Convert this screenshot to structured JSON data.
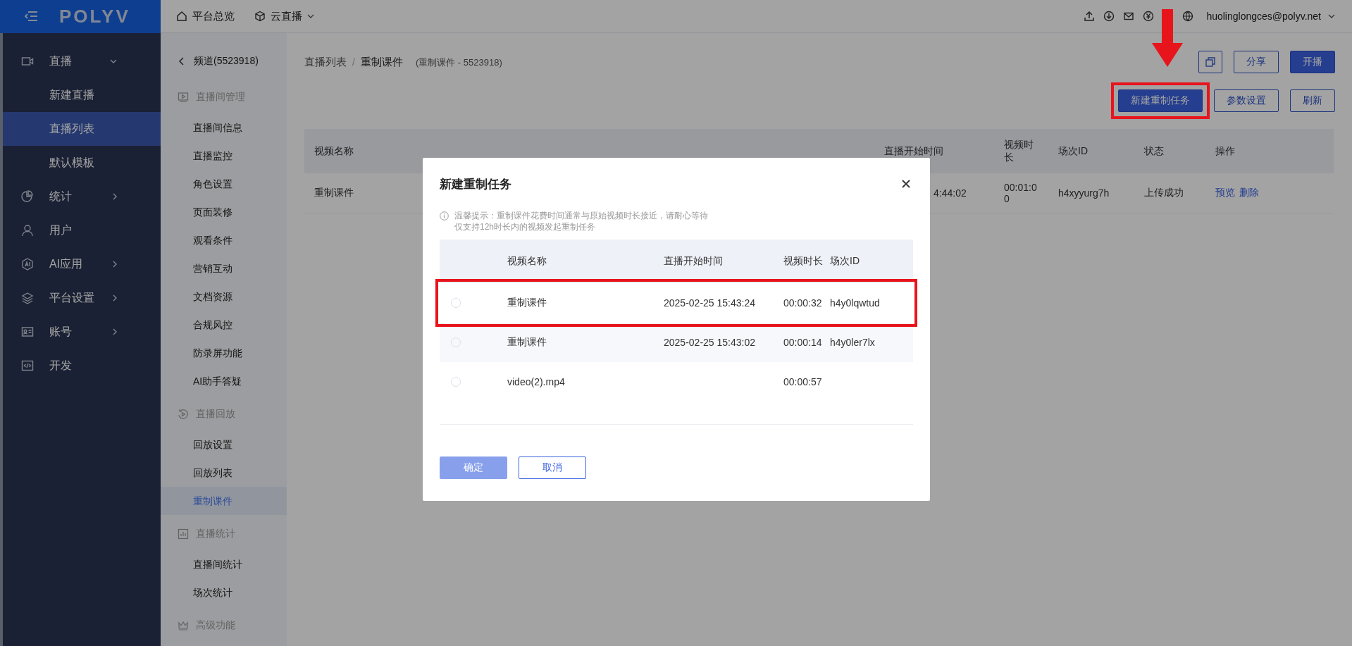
{
  "topbar": {
    "logo": "POLYV",
    "nav": [
      {
        "label": "平台总览",
        "dropdown": false
      },
      {
        "label": "云直播",
        "dropdown": true
      }
    ],
    "user": "huolinglongces@polyv.net"
  },
  "sidebar": {
    "items": [
      {
        "label": "直播",
        "selected": false,
        "expanded": true,
        "children": [
          {
            "label": "新建直播",
            "selected": false
          },
          {
            "label": "直播列表",
            "selected": true
          },
          {
            "label": "默认模板",
            "selected": false
          }
        ]
      },
      {
        "label": "统计",
        "selected": false,
        "expanded": false
      },
      {
        "label": "用户",
        "selected": false
      },
      {
        "label": "AI应用",
        "selected": false,
        "expanded": false
      },
      {
        "label": "平台设置",
        "selected": false,
        "expanded": false
      },
      {
        "label": "账号",
        "selected": false,
        "expanded": false
      },
      {
        "label": "开发",
        "selected": false
      }
    ]
  },
  "subnav": {
    "back": "频道(5523918)",
    "groups": [
      {
        "title": "直播间管理",
        "items": [
          {
            "label": "直播间信息",
            "selected": false
          },
          {
            "label": "直播监控",
            "selected": false
          },
          {
            "label": "角色设置",
            "selected": false
          },
          {
            "label": "页面装修",
            "selected": false
          },
          {
            "label": "观看条件",
            "selected": false
          },
          {
            "label": "营销互动",
            "selected": false
          },
          {
            "label": "文档资源",
            "selected": false
          },
          {
            "label": "合规风控",
            "selected": false
          },
          {
            "label": "防录屏功能",
            "selected": false
          },
          {
            "label": "AI助手答疑",
            "selected": false
          }
        ]
      },
      {
        "title": "直播回放",
        "items": [
          {
            "label": "回放设置",
            "selected": false
          },
          {
            "label": "回放列表",
            "selected": false
          },
          {
            "label": "重制课件",
            "selected": true
          }
        ]
      },
      {
        "title": "直播统计",
        "items": [
          {
            "label": "直播间统计",
            "selected": false
          },
          {
            "label": "场次统计",
            "selected": false
          }
        ]
      },
      {
        "title": "高级功能"
      }
    ]
  },
  "page": {
    "breadcrumb": [
      "直播列表",
      "重制课件"
    ],
    "breadcrumb_separator": "/",
    "subtitle": "(重制课件 - 5523918)",
    "header_buttons": [
      {
        "label": "分享",
        "primary": false
      },
      {
        "label": "开播",
        "primary": true
      }
    ],
    "actions": [
      {
        "label": "新建重制任务",
        "primary": true,
        "highlighted": true
      },
      {
        "label": "参数设置",
        "primary": false,
        "highlighted": false
      },
      {
        "label": "刷新",
        "primary": false,
        "highlighted": false
      }
    ],
    "table": {
      "columns": [
        "视频名称",
        "直播开始时间",
        "视频时长",
        "场次ID",
        "状态",
        "操作"
      ],
      "rows": [
        {
          "name": "重制课件",
          "start": "4:44:02",
          "duration": "00:01:00",
          "session_id": "h4xyyurg7h",
          "status": "上传成功",
          "links": [
            "预览",
            "删除"
          ]
        }
      ]
    }
  },
  "modal": {
    "title": "新建重制任务",
    "hint": [
      "温馨提示：重制课件花费时间通常与原始视频时长接近，请耐心等待",
      "仅支持12h时长内的视频发起重制任务"
    ],
    "columns": [
      "视频名称",
      "直播开始时间",
      "视频时长",
      "场次ID"
    ],
    "rows": [
      {
        "selected": false,
        "highlighted": true,
        "name": "重制课件",
        "start": "2025-02-25 15:43:24",
        "duration": "00:00:32",
        "session_id": "h4y0lqwtud"
      },
      {
        "selected": false,
        "highlighted": false,
        "name": "重制课件",
        "start": "2025-02-25 15:43:02",
        "duration": "00:00:14",
        "session_id": "h4y0ler7lx"
      },
      {
        "selected": false,
        "highlighted": false,
        "name": "video(2).mp4",
        "duration": "00:00:57"
      }
    ],
    "buttons": [
      {
        "label": "确定",
        "primary": true,
        "disabled": true
      },
      {
        "label": "取消",
        "primary": false,
        "disabled": false
      }
    ]
  }
}
